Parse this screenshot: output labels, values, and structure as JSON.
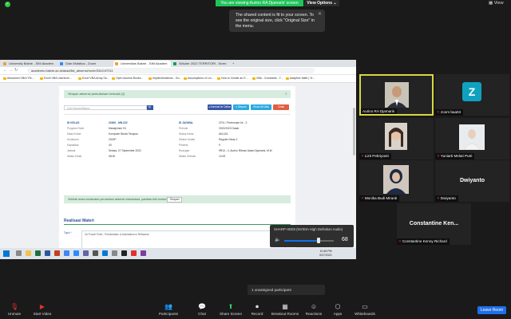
{
  "top": {
    "viewing_banner": "You are viewing Aurino RA Djamaris' screen",
    "view_options": "View Options ⌄",
    "view_label": "View",
    "tooltip_text": "The shared content is fit to your screen. To see the original size, click \"Original Size\" in the menu."
  },
  "browser": {
    "tabs": [
      "University Bakrie - SIM Akadem",
      "Dian Mufatica - Zoom",
      "Universitas Bakrie - SIM Akadem",
      "Sirkuler 2022 TERRITORI - Norm"
    ],
    "url": "academic.bakrie.ac.id/akad/list_absensi/route/3342/47011",
    "bookmarks": [
      "Advanced VBA f Re...",
      "Excel VBA Userform...",
      "Excel VBA Array Gu...",
      "Open Access Books...",
      "Implementations - Go...",
      "Assumptions of Lin...",
      "How to Create an E...",
      "VBA - Constants - T...",
      "Adaptive Math | Vi..."
    ]
  },
  "page": {
    "alert_top": "Simpan absensi perkuliahan berhasil (2)",
    "search_placeholder": "Cari Nomor/Nama",
    "search_icon": "🔍",
    "btn_kembali": "◂ Kembali ke Daftar",
    "btn_simpan": "▾ Simpan",
    "btn_show_all": "Show All Data",
    "btn_cetak": "Cetak",
    "fields_left": [
      {
        "label": "ID KELAS",
        "value": "21840 - MN.222"
      },
      {
        "label": "Program Studi",
        "value": "Manajemen S1"
      },
      {
        "label": "Mata Kuliah",
        "value": "Komputer Bisnis Terapan"
      },
      {
        "label": "Kurikulum",
        "value": "2019P"
      },
      {
        "label": "Kapasitas",
        "value": "40"
      },
      {
        "label": "Jadwal",
        "value": "Selasa, 27 September 2022"
      },
      {
        "label": "Waktu Mulai",
        "value": "08:00"
      }
    ],
    "fields_right": [
      {
        "label": "ID JADWAL",
        "value": "3701 / Pertemuan ke - 3"
      },
      {
        "label": "Periode",
        "value": "2022/2023 Gasal"
      },
      {
        "label": "Status Kelas",
        "value": "AKLIZA"
      },
      {
        "label": "Sistem Kuliah",
        "value": "Reguler Kelas 2"
      },
      {
        "label": "Peserta",
        "value": "9"
      },
      {
        "label": "Ruangan",
        "value": "9R14 - 4. Aurino Rilman Adam Djamaris, M.M"
      },
      {
        "label": "Waktu Selesai",
        "value": "10:00"
      }
    ],
    "alert_mid": "Setelah anda melakukan perubahan absensi mahasiswa, pastikan klik tombol",
    "alert_mid_btn": "Simpan",
    "realisasi_title": "Realisasi Materi",
    "topic_label": "Topic *",
    "topic_value": "On Power Point - Presentation & Animations in Rehearse",
    "ref_label": "Referensi*",
    "ref_value": "Microsoft Power Point Documentation"
  },
  "taskbar": {
    "clock": "10:45 PM",
    "date": "9/27/2022"
  },
  "audio": {
    "device": "SHARP HDMI (NVIDIA High Definition Audio)",
    "volume": 68,
    "volume_fraction": 0.7
  },
  "participants": [
    {
      "name": "Aurino RA Djamaris",
      "muted": false
    },
    {
      "name": "zoom baa04",
      "muted": true,
      "initial": "Z"
    },
    {
      "name": "Lizti Pebriyanti",
      "muted": true
    },
    {
      "name": "Yuniarti Melati Putri",
      "muted": true
    },
    {
      "name": "Monika Budi Miranti",
      "muted": true
    },
    {
      "name": "Dwiyanto",
      "muted": true,
      "big": "Dwiyanto"
    },
    {
      "name": "Constantine Kenny Richard",
      "muted": true,
      "big": "Constantine  Ken..."
    }
  ],
  "unassigned": "1 unassigned participant",
  "toolbar": {
    "unmute": "Unmute",
    "start_video": "Start Video",
    "participants": "Participants",
    "participants_count": "7",
    "chat": "Chat",
    "share_screen": "Share Screen",
    "record": "Record",
    "breakout": "Breakout Rooms",
    "reactions": "Reactions",
    "apps": "Apps",
    "whiteboards": "Whiteboards",
    "leave": "Leave Room"
  },
  "colors": {
    "accent": "#0e72ed",
    "share_green": "#21c35a",
    "leave_blue": "#1f6feb",
    "active_border": "#d8d83f"
  }
}
